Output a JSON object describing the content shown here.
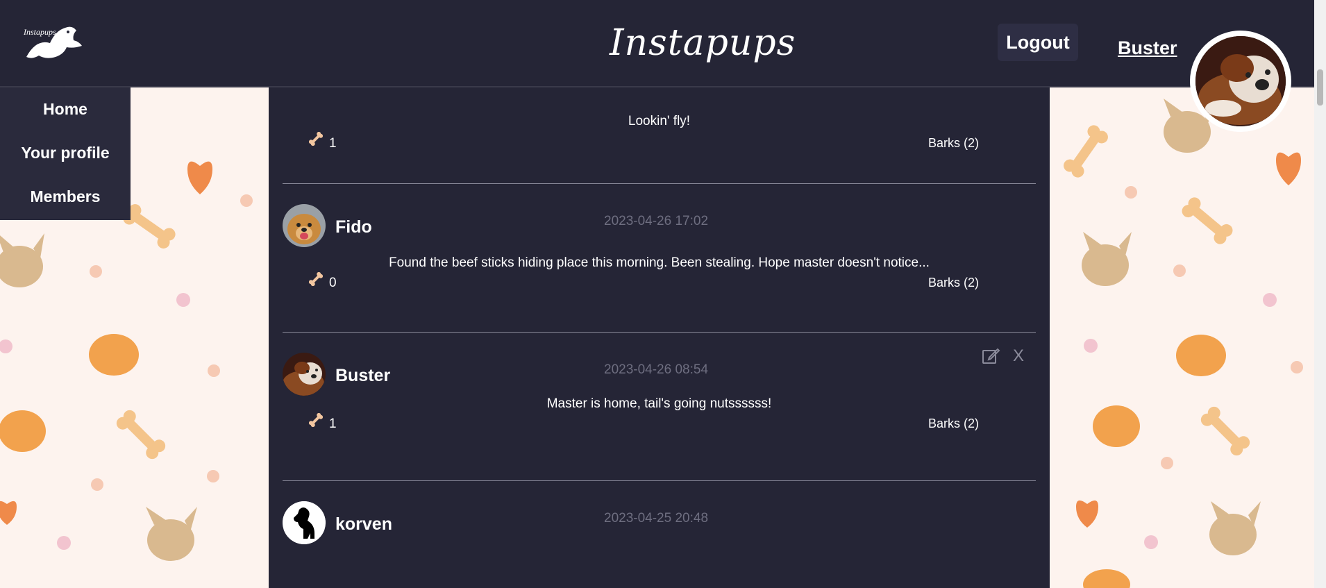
{
  "header": {
    "logo_text": "Instapups",
    "brand_title": "Instapups",
    "logout_label": "Logout",
    "username": "Buster"
  },
  "nav": {
    "items": [
      {
        "label": "Home"
      },
      {
        "label": "Your profile"
      },
      {
        "label": "Members"
      }
    ]
  },
  "posts": [
    {
      "author": "",
      "time": "",
      "text": "Lookin' fly!",
      "bones": "1",
      "barks": "Barks (2)"
    },
    {
      "author": "Fido",
      "time": "2023-04-26 17:02",
      "text": "Found the beef sticks hiding place this morning. Been stealing. Hope master doesn't notice...",
      "bones": "0",
      "barks": "Barks (2)"
    },
    {
      "author": "Buster",
      "time": "2023-04-26 08:54",
      "text": "Master is home, tail's going nutssssss!",
      "bones": "1",
      "barks": "Barks (2)",
      "delete_label": "X"
    },
    {
      "author": "korven",
      "time": "2023-04-25 20:48"
    }
  ],
  "colors": {
    "header_bg": "#252536",
    "feed_bg": "#252536",
    "nav_bg": "#2a2a3c",
    "page_bg": "#fdf3ee",
    "bone": "#f2c6a0"
  },
  "icons": [
    "paw-logo-icon",
    "bone-icon",
    "edit-icon",
    "close-icon"
  ]
}
